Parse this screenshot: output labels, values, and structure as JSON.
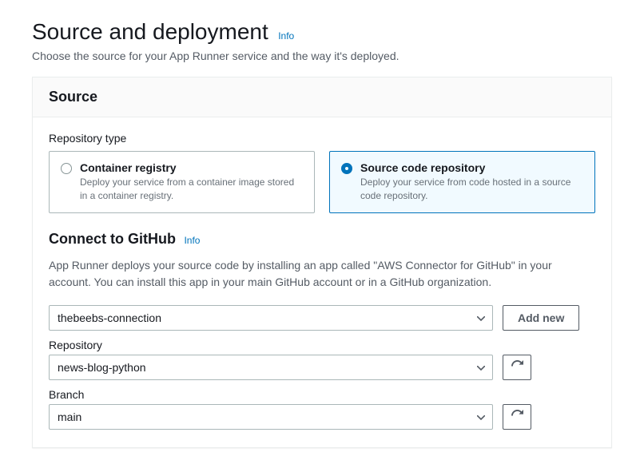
{
  "page": {
    "title": "Source and deployment",
    "info": "Info",
    "description": "Choose the source for your App Runner service and the way it's deployed."
  },
  "source": {
    "panel_title": "Source",
    "repo_type_label": "Repository type",
    "options": [
      {
        "title": "Container registry",
        "desc": "Deploy your service from a container image stored in a container registry.",
        "selected": false
      },
      {
        "title": "Source code repository",
        "desc": "Deploy your service from code hosted in a source code repository.",
        "selected": true
      }
    ]
  },
  "github": {
    "title": "Connect to GitHub",
    "info": "Info",
    "description": "App Runner deploys your source code by installing an app called \"AWS Connector for GitHub\" in your account. You can install this app in your main GitHub account or in a GitHub organization.",
    "connection_value": "thebeebs-connection",
    "add_new_label": "Add new",
    "repository_label": "Repository",
    "repository_value": "news-blog-python",
    "branch_label": "Branch",
    "branch_value": "main"
  }
}
